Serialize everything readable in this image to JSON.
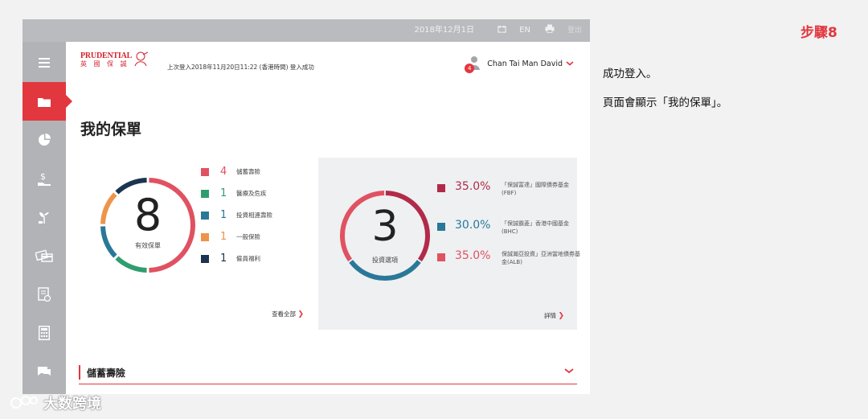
{
  "topbar": {
    "date": "2018年12月1日",
    "lang": "EN",
    "logout": "登出"
  },
  "logo": {
    "line1": "PRUDENTIAL",
    "line2": "英 國 保 誠"
  },
  "last_login": "上次登入2018年11月20日11:22 (香港時間) 登入成功",
  "user": {
    "name": "Chan Tai Man David",
    "badge": "4"
  },
  "page_title": "我的保單",
  "policies": {
    "total": "8",
    "total_label": "有效保單",
    "items": [
      {
        "count": "4",
        "label": "儲蓄壽險",
        "color": "#e05262"
      },
      {
        "count": "1",
        "label": "醫療及危疾",
        "color": "#2f9e6e"
      },
      {
        "count": "1",
        "label": "投資相連壽險",
        "color": "#2a7898"
      },
      {
        "count": "1",
        "label": "一般保險",
        "color": "#ee944a"
      },
      {
        "count": "1",
        "label": "僱員福利",
        "color": "#1c3450"
      }
    ],
    "view_all": "查看全部"
  },
  "investments": {
    "total": "3",
    "total_label": "投資選項",
    "items": [
      {
        "pct": "35.0%",
        "name": "「保誠富達」國際債券基金(FBF)",
        "color": "#b22a49"
      },
      {
        "pct": "30.0%",
        "name": "「保誠霸菱」香港中國基金(BHC)",
        "color": "#2a7898"
      },
      {
        "pct": "35.0%",
        "name": "保誠瀚亞投資」亞洲當地債券基金(ALB)",
        "color": "#e05262"
      }
    ],
    "details": "詳情"
  },
  "section": {
    "title": "儲蓄壽險"
  },
  "instructions": {
    "step": "步驟8",
    "line1": "成功登入。",
    "line2": "頁面會顯示「我的保單」。"
  },
  "watermark": "大数跨境"
}
